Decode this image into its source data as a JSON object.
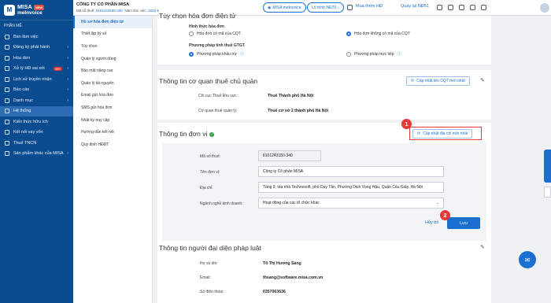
{
  "brand": {
    "line1": "MISA",
    "line2": "meInvoice",
    "badge": "NEW"
  },
  "version_label": "PHẦN MỀ",
  "nav": [
    {
      "label": "Bàn làm việc",
      "chevron": false
    },
    {
      "label": "Đăng ký phát hành",
      "chevron": true
    },
    {
      "label": "Hóa đơn",
      "chevron": true
    },
    {
      "label": "Xử lý HĐ sai sót",
      "chevron": true,
      "badge": "99+"
    },
    {
      "label": "Lịch sử truyền nhận",
      "chevron": true
    },
    {
      "label": "Báo cáo",
      "chevron": true
    },
    {
      "label": "Danh mục",
      "chevron": true
    },
    {
      "label": "Hệ thống",
      "chevron": false,
      "active": true
    },
    {
      "label": "Kiến thức hữu ích",
      "chevron": false
    },
    {
      "label": "Kết nối vay vốn",
      "chevron": false
    },
    {
      "label": "Thuế TNCN",
      "chevron": false
    },
    {
      "label": "Sản phẩm khác của MISA",
      "chevron": true
    }
  ],
  "header": {
    "company": "CÔNG TY CỔ PHẦN MISA",
    "tax_code_label": "Mã số thuế:",
    "tax_code": "0101243150-340",
    "year_label": "Năm làm việc:",
    "year": "2025",
    "misa_btn": "MISA meInvoice",
    "decree_btn": "Lộ trình NĐ70",
    "buy_more": "Mua thêm HĐ",
    "back_decree": "Quay lại NĐ51"
  },
  "settings_menu": [
    {
      "label": "Hồ sơ hóa đơn điện tử",
      "active": true
    },
    {
      "label": "Thiết lập ký số"
    },
    {
      "label": "Tùy chọn"
    },
    {
      "label": "Quản lý người dùng"
    },
    {
      "label": "Bảo mật nâng cao"
    },
    {
      "label": "Quản lý tài nguyên"
    },
    {
      "label": "Email gửi hóa đơn"
    },
    {
      "label": "SMS gửi hóa đơn"
    },
    {
      "label": "Nhật ký truy cập"
    },
    {
      "label": "Hướng dẫn kết nối"
    },
    {
      "label": "Quy định HĐĐT"
    }
  ],
  "invoice_options": {
    "title": "Tùy chọn hóa đơn điện tử",
    "form_label": "Hình thức hóa đơn",
    "opt_with_code": "Hóa đơn có mã của CQT",
    "opt_without_code": "Hóa đơn không có mã của CQT",
    "method_label": "Phương pháp tính thuế GTGT",
    "opt_deduction": "Phương pháp khấu trừ",
    "opt_direct": "Phương pháp trực tiếp"
  },
  "tax_authority": {
    "title": "Thông tin cơ quan thuế chủ quản",
    "update_btn": "Cập nhật tên CQT mới nhất",
    "branch_label": "Chi cục Thuế khu vực:",
    "branch_value": "Thuế Thành phố Hà Nội",
    "manager_label": "Cơ quan thuế quản lý:",
    "manager_value": "Thuế cơ sở 2 thành phố Hà Nội"
  },
  "unit_info": {
    "title": "Thông tin đơn vị",
    "update_btn": "Cập nhật địa chỉ mới nhất",
    "tax_label": "Mã số thuế:",
    "tax_value": "0101243150-340",
    "name_label": "Tên đơn vị:",
    "name_value": "Công ty Cổ phần MISA",
    "addr_label": "Địa chỉ:",
    "addr_value": "Tầng 9, tòa nhà Technosoft, phố Duy Tân, Phường Dịch Vọng Hậu, Quận Cầu Giấy, Hà Nội",
    "business_label": "Ngành nghề kinh doanh:",
    "business_value": "Hoạt động của các tổ chức khác",
    "cancel": "Hủy bỏ",
    "save": "Lưu"
  },
  "legal_rep": {
    "title": "Thông tin người đại diện pháp luật",
    "name_label": "Họ và tên:",
    "name_value": "Tô Thị Hương Sáng",
    "email_label": "Email:",
    "email_value": "thsang@software.misa.com.vn",
    "phone_label": "Số điện thoại:",
    "phone_value": "0357063636"
  },
  "callouts": {
    "one": "1",
    "two": "2"
  },
  "colors": {
    "nav": "#0b4b8f",
    "accent": "#1a6fd0",
    "callout": "#e53935"
  }
}
